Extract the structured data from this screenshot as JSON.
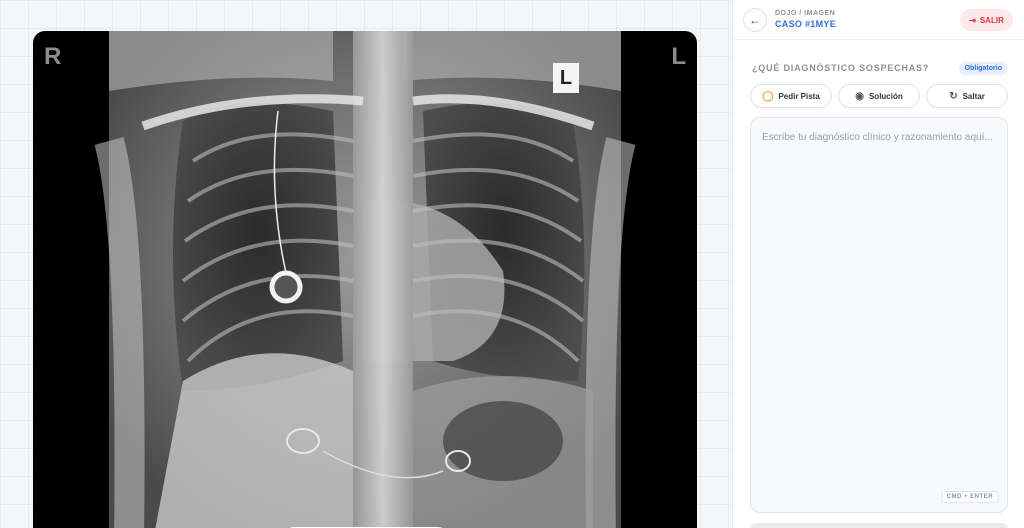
{
  "viewer": {
    "left_marker": "R",
    "right_marker": "L",
    "film_marker": "L"
  },
  "header": {
    "breadcrumb": "DOJO / IMAGEN",
    "case_id": "CASO #1MYE",
    "exit_label": "SALIR"
  },
  "question": {
    "label": "¿QUÉ DIAGNÓSTICO SOSPECHAS?",
    "badge": "Obligatorio"
  },
  "actions": {
    "hint_label": "Pedir Pista",
    "solution_label": "Solución",
    "skip_label": "Saltar"
  },
  "answer": {
    "placeholder": "Escribe tu diagnóstico clínico y razonamiento aquí...",
    "value": "",
    "shortcut": "CMD + ENTER"
  },
  "colors": {
    "accent": "#2f6fe0",
    "danger": "#e0323f",
    "hint": "#f29a2e"
  }
}
